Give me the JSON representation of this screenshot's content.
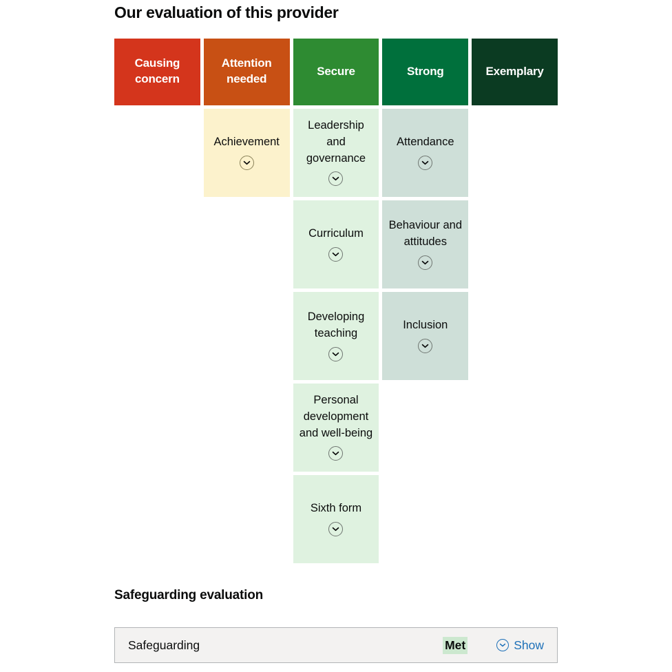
{
  "page": {
    "title": "Our evaluation of this provider",
    "safeguarding_heading": "Safeguarding evaluation"
  },
  "bands": [
    {
      "label": "Causing concern",
      "color": "#d4351c"
    },
    {
      "label": "Attention needed",
      "color": "#c85014"
    },
    {
      "label": "Secure",
      "color": "#2e8b32"
    },
    {
      "label": "Strong",
      "color": "#00703c"
    },
    {
      "label": "Exemplary",
      "color": "#0b3b22"
    }
  ],
  "colors": {
    "cell_attention": "#fcf2cc",
    "cell_secure": "#dff2e0",
    "cell_strong": "#cedfd8",
    "highlight_met": "#cce8cf",
    "link": "#1d70b8",
    "box_bg": "#f3f2f1",
    "box_border": "#b1b4b6"
  },
  "judgements": [
    {
      "label": "Achievement",
      "band": "Attention needed",
      "column": 2,
      "row": 1,
      "toggle": "chevron-down-icon"
    },
    {
      "label": "Leadership and governance",
      "band": "Secure",
      "column": 3,
      "row": 1,
      "toggle": "chevron-down-icon"
    },
    {
      "label": "Attendance",
      "band": "Strong",
      "column": 4,
      "row": 1,
      "toggle": "chevron-down-icon"
    },
    {
      "label": "Curriculum",
      "band": "Secure",
      "column": 3,
      "row": 2,
      "toggle": "chevron-down-icon"
    },
    {
      "label": "Behaviour and attitudes",
      "band": "Strong",
      "column": 4,
      "row": 2,
      "toggle": "chevron-down-icon"
    },
    {
      "label": "Developing teaching",
      "band": "Secure",
      "column": 3,
      "row": 3,
      "toggle": "chevron-down-icon"
    },
    {
      "label": "Inclusion",
      "band": "Strong",
      "column": 4,
      "row": 3,
      "toggle": "chevron-down-icon"
    },
    {
      "label": "Personal development and well-being",
      "band": "Secure",
      "column": 3,
      "row": 4,
      "toggle": "chevron-down-icon"
    },
    {
      "label": "Sixth form",
      "band": "Secure",
      "column": 3,
      "row": 5,
      "toggle": "chevron-down-icon"
    }
  ],
  "safeguarding": {
    "name": "Safeguarding",
    "outcome": "Met",
    "show_label": "Show",
    "show_icon": "chevron-down-circle-icon"
  }
}
